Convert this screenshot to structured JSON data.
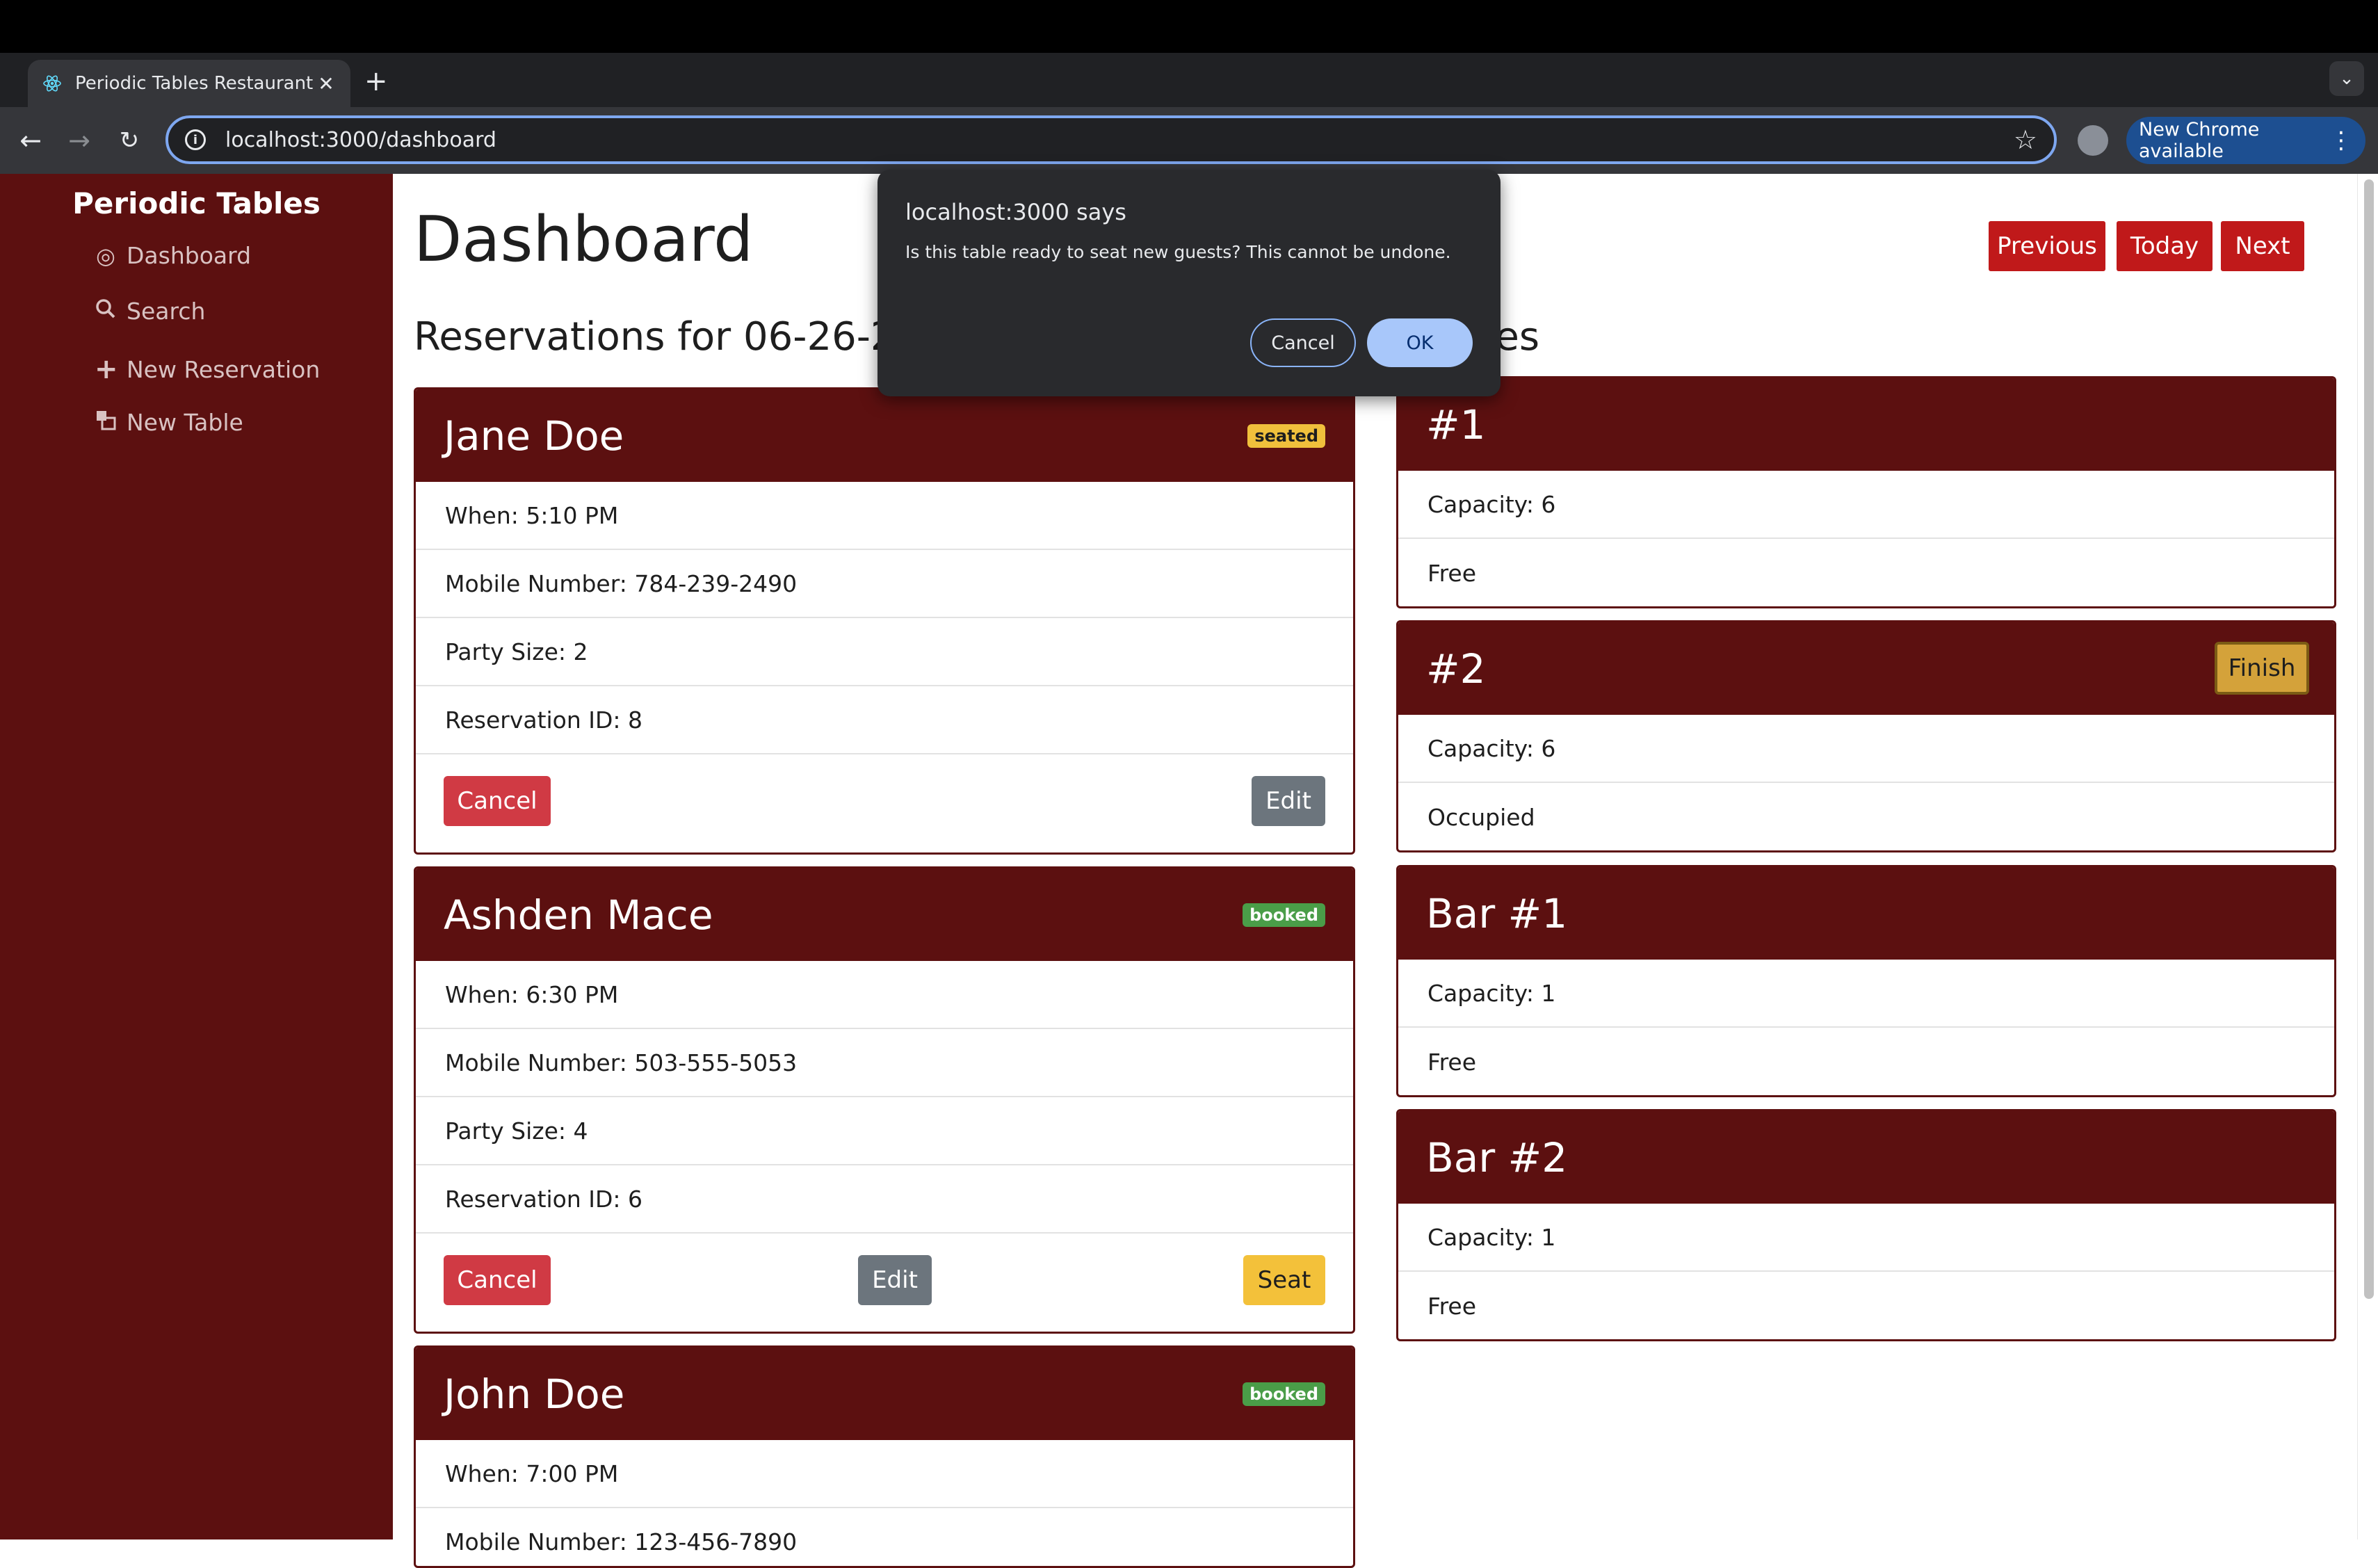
{
  "browser": {
    "tab_title": "Periodic Tables Restaurant Re",
    "tab_close": "✕",
    "new_tab": "+",
    "tab_menu": "⌄",
    "url": "localhost:3000/dashboard",
    "update_label": "New Chrome available",
    "menu_dots": "⋮"
  },
  "sidebar": {
    "brand": "Periodic Tables",
    "items": [
      {
        "label": "Dashboard",
        "icon": "dashboard-icon"
      },
      {
        "label": "Search",
        "icon": "search-icon"
      },
      {
        "label": "New Reservation",
        "icon": "plus-icon"
      },
      {
        "label": "New Table",
        "icon": "table-icon"
      }
    ]
  },
  "main": {
    "title": "Dashboard",
    "subtitle": "Reservations for 06-26-2024",
    "tables_heading": "Tables",
    "nav": {
      "previous": "Previous",
      "today": "Today",
      "next": "Next"
    }
  },
  "reservations": [
    {
      "name": "Jane Doe",
      "status": "seated",
      "when": "When: 5:10 PM",
      "mobile": "Mobile Number: 784-239-2490",
      "party": "Party Size: 2",
      "id": "Reservation ID: 8",
      "cancel": "Cancel",
      "edit": "Edit"
    },
    {
      "name": "Ashden Mace",
      "status": "booked",
      "when": "When: 6:30 PM",
      "mobile": "Mobile Number: 503-555-5053",
      "party": "Party Size: 4",
      "id": "Reservation ID: 6",
      "cancel": "Cancel",
      "edit": "Edit",
      "seat": "Seat"
    },
    {
      "name": "John Doe",
      "status": "booked",
      "when": "When: 7:00 PM",
      "mobile": "Mobile Number: 123-456-7890"
    }
  ],
  "tables": [
    {
      "name": "#1",
      "capacity": "Capacity: 6",
      "status": "Free"
    },
    {
      "name": "#2",
      "capacity": "Capacity: 6",
      "status": "Occupied",
      "finish": "Finish"
    },
    {
      "name": "Bar #1",
      "capacity": "Capacity: 1",
      "status": "Free"
    },
    {
      "name": "Bar #2",
      "capacity": "Capacity: 1",
      "status": "Free"
    }
  ],
  "dialog": {
    "title": "localhost:3000 says",
    "message": "Is this table ready to seat new guests? This cannot be undone.",
    "cancel": "Cancel",
    "ok": "OK"
  },
  "colors": {
    "brand_maroon": "#5c1010",
    "nav_red": "#c0191a",
    "seated_badge": "#f0c03c",
    "booked_badge": "#4a9d48"
  }
}
